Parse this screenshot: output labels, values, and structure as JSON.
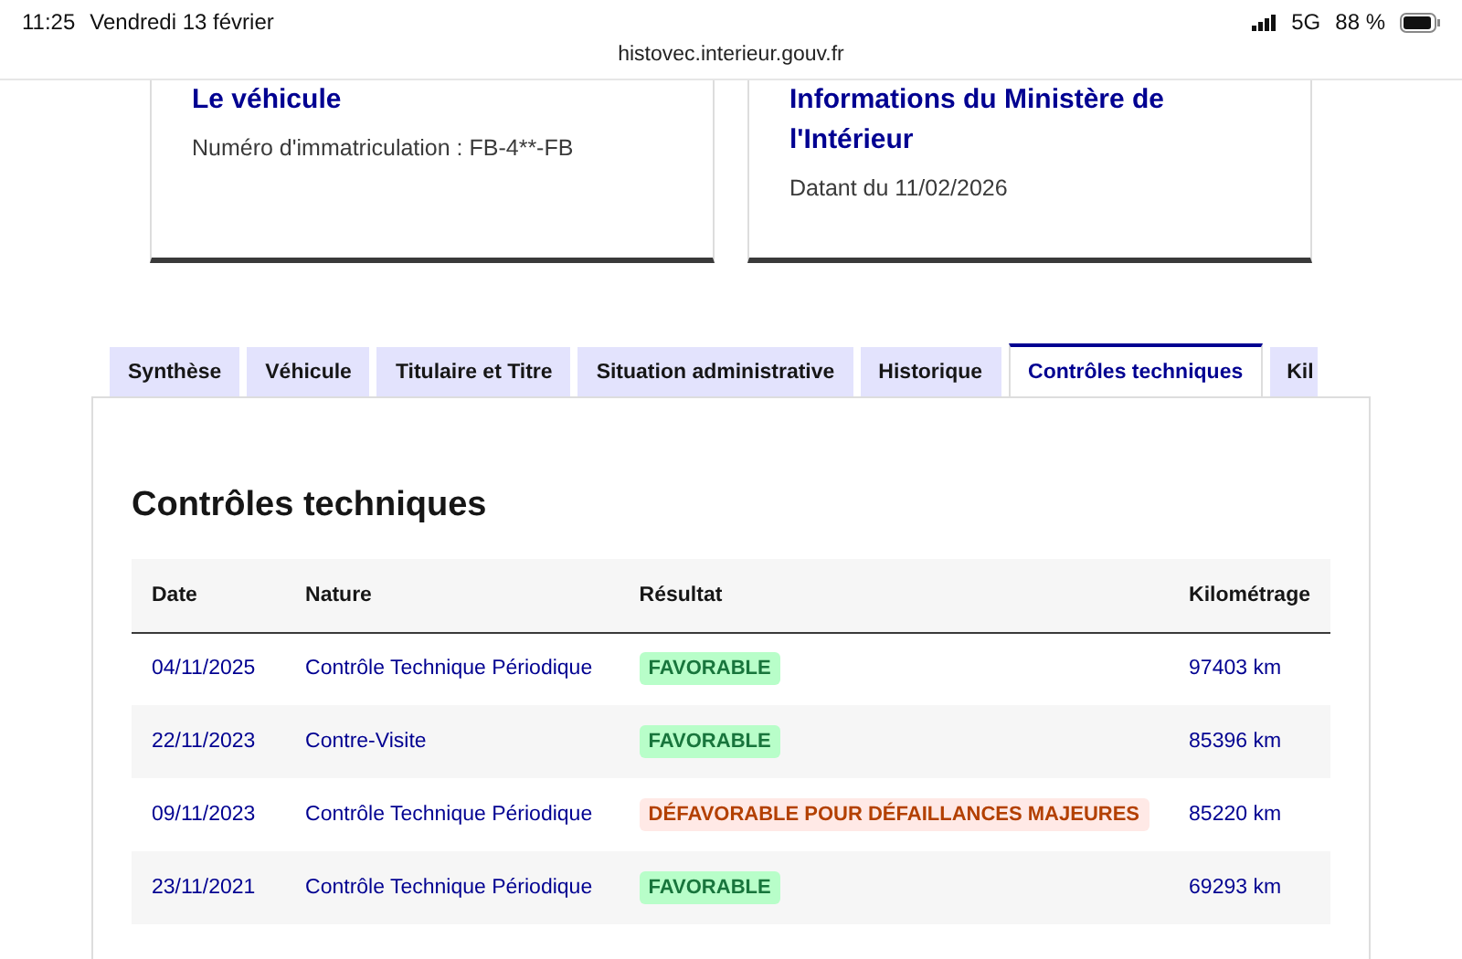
{
  "status_bar": {
    "time": "11:25",
    "date": "Vendredi 13 février",
    "network": "5G",
    "battery": "88 %"
  },
  "address_bar": {
    "url": "histovec.interieur.gouv.fr"
  },
  "cards": [
    {
      "title": "Le véhicule",
      "text": "Numéro d'immatriculation : FB-4**-FB"
    },
    {
      "title": "Informations du Ministère de l'Intérieur",
      "text": "Datant du 11/02/2026"
    }
  ],
  "tabs": [
    {
      "label": "Synthèse",
      "selected": false
    },
    {
      "label": "Véhicule",
      "selected": false
    },
    {
      "label": "Titulaire et Titre",
      "selected": false
    },
    {
      "label": "Situation administrative",
      "selected": false
    },
    {
      "label": "Historique",
      "selected": false
    },
    {
      "label": "Contrôles techniques",
      "selected": true
    },
    {
      "label": "Kil",
      "selected": false
    }
  ],
  "section": {
    "title": "Contrôles techniques",
    "table": {
      "columns": [
        "Date",
        "Nature",
        "Résultat",
        "Kilométrage"
      ],
      "rows": [
        {
          "date": "04/11/2025",
          "nature": "Contrôle Technique Périodique",
          "result": {
            "label": "FAVORABLE",
            "kind": "success"
          },
          "mileage": "97403 km"
        },
        {
          "date": "22/11/2023",
          "nature": "Contre-Visite",
          "result": {
            "label": "FAVORABLE",
            "kind": "success"
          },
          "mileage": "85396 km"
        },
        {
          "date": "09/11/2023",
          "nature": "Contrôle Technique Périodique",
          "result": {
            "label": "DÉFAVORABLE POUR DÉFAILLANCES MAJEURES",
            "kind": "error"
          },
          "mileage": "85220 km"
        },
        {
          "date": "23/11/2021",
          "nature": "Contrôle Technique Périodique",
          "result": {
            "label": "FAVORABLE",
            "kind": "success"
          },
          "mileage": "69293 km"
        }
      ]
    }
  }
}
